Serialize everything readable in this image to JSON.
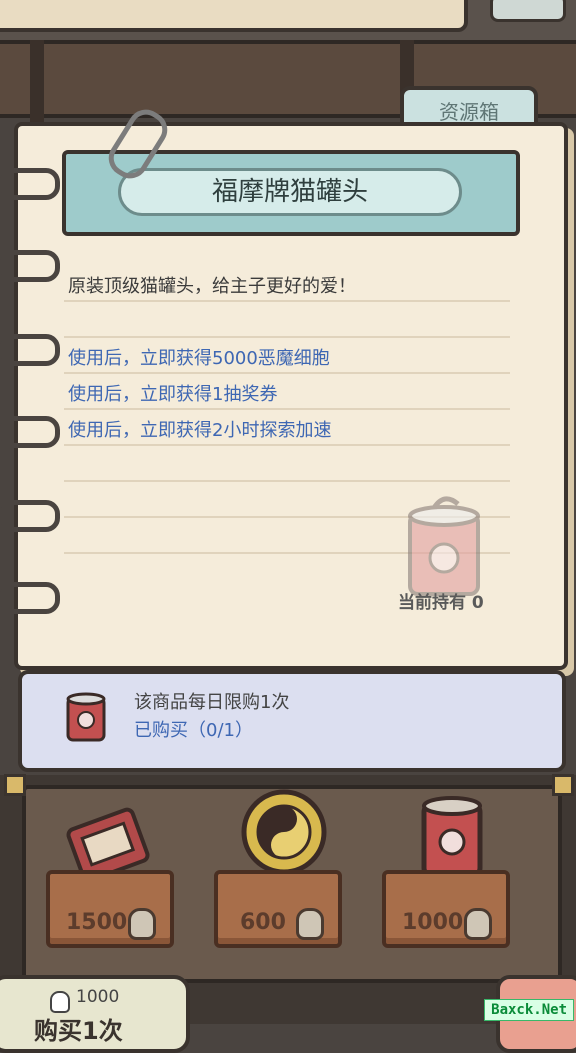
{
  "tab": {
    "label": "资源箱"
  },
  "item": {
    "title": "福摩牌猫罐头",
    "description": "原装顶级猫罐头，给主子更好的爱！",
    "effects": [
      "使用后，立即获得5000恶魔细胞",
      "使用后，立即获得1抽奖券",
      "使用后，立即获得2小时探索加速"
    ],
    "holding": "当前持有 0"
  },
  "limit": {
    "daily_text": "该商品每日限购1次",
    "purchased_text": "已购买（0/1）"
  },
  "shop_items": [
    {
      "price": "1500",
      "icon": "ticket-icon"
    },
    {
      "price": "600",
      "icon": "yin-yang-coin-icon"
    },
    {
      "price": "1000",
      "icon": "cat-can-icon"
    }
  ],
  "buy": {
    "price": "1000",
    "label": "购买1次"
  },
  "watermark": "Baxck.Net",
  "colors": {
    "blue_text": "#3e67b3",
    "title_plate": "#9ecbcb",
    "paper": "#f5ecda"
  }
}
